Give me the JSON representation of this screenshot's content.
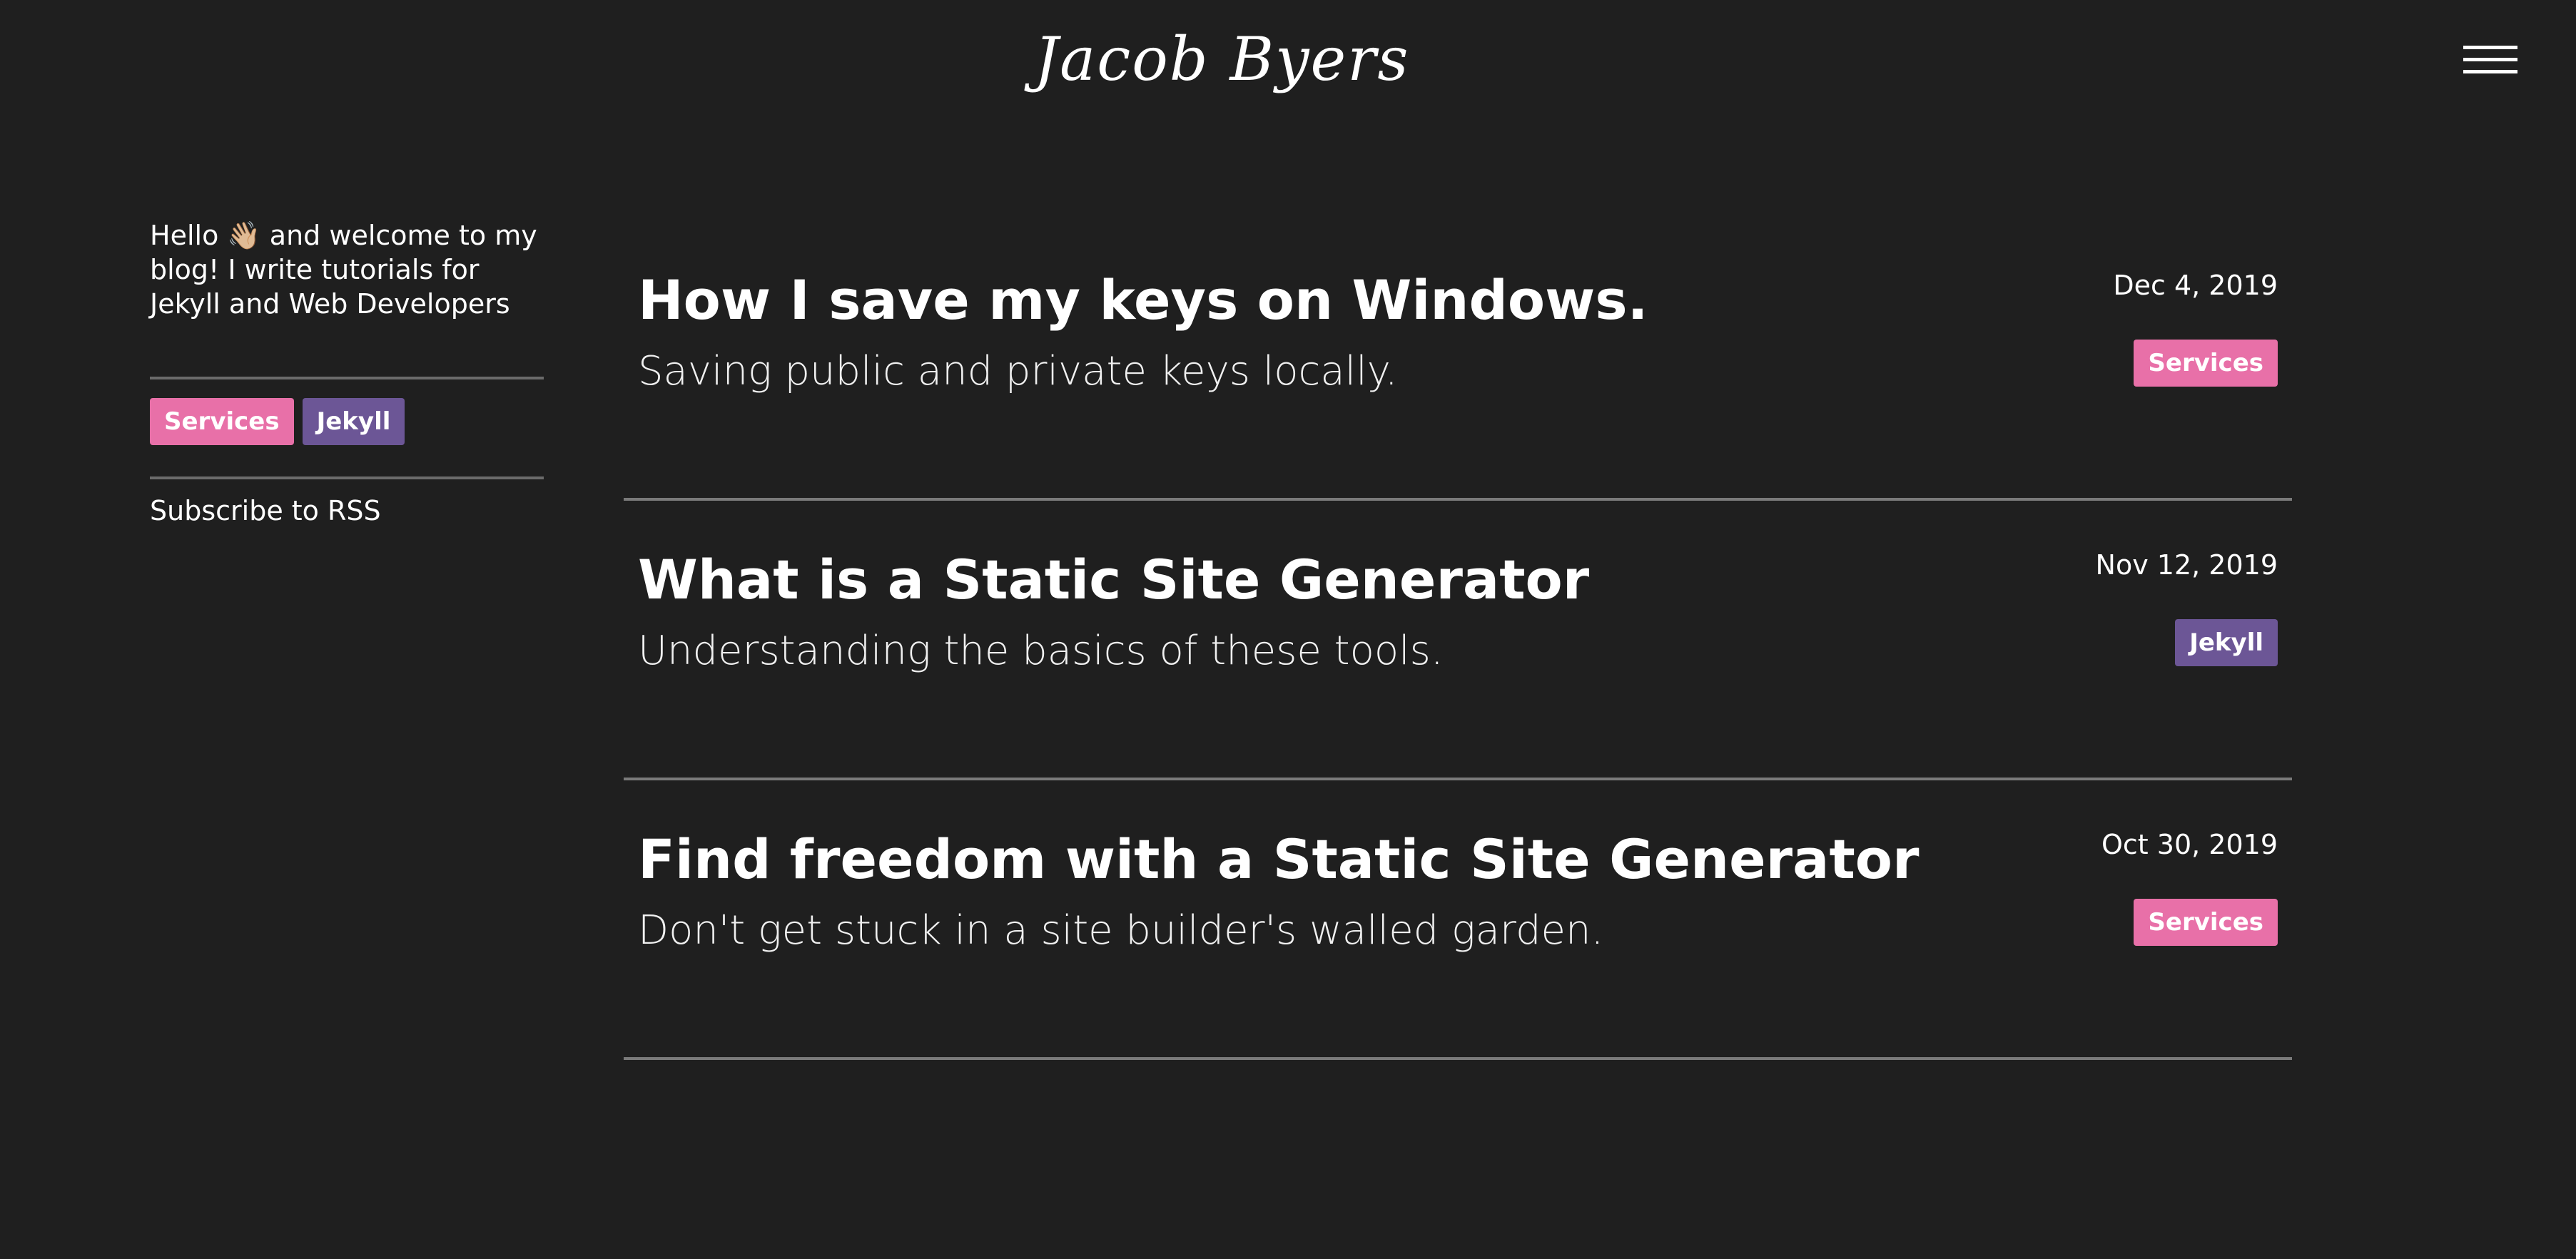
{
  "header": {
    "site_title": "Jacob Byers",
    "menu_icon": "hamburger-menu-icon"
  },
  "sidebar": {
    "intro": "Hello 👋🏼 and welcome to my blog! I write tutorials for Jekyll and Web Developers",
    "tags": [
      {
        "label": "Services",
        "color": "#e870a8"
      },
      {
        "label": "Jekyll",
        "color": "#6c5696"
      }
    ],
    "rss_label": "Subscribe to RSS"
  },
  "posts": [
    {
      "title": "How I save my keys on Windows.",
      "subtitle": "Saving public and private keys locally.",
      "date": "Dec 4, 2019",
      "tag": "Services"
    },
    {
      "title": "What is a Static Site Generator",
      "subtitle": "Understanding the basics of these tools.",
      "date": "Nov 12, 2019",
      "tag": "Jekyll"
    },
    {
      "title": "Find freedom with a Static Site Generator",
      "subtitle": "Don't get stuck in a site builder's walled garden.",
      "date": "Oct 30, 2019",
      "tag": "Services"
    }
  ],
  "colors": {
    "background": "#1f1f1f",
    "services_tag": "#e870a8",
    "jekyll_tag": "#6c5696",
    "divider": "#7a7a7a"
  }
}
